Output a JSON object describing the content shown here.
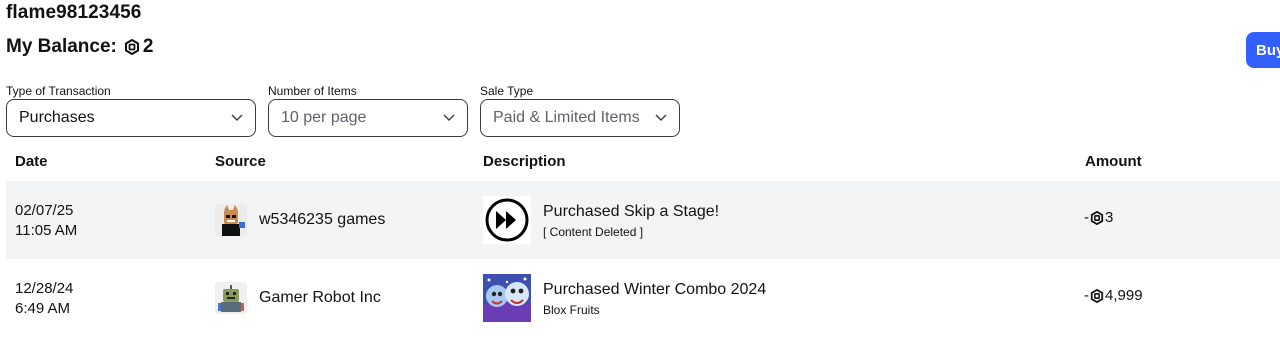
{
  "header": {
    "username": "flame98123456",
    "balance_label": "My Balance:",
    "balance_value": "2",
    "buy_label": "Buy"
  },
  "filters": {
    "type": {
      "label": "Type of Transaction",
      "value": "Purchases"
    },
    "count": {
      "label": "Number of Items",
      "value": "10 per page"
    },
    "sale": {
      "label": "Sale Type",
      "value": "Paid & Limited Items"
    }
  },
  "table": {
    "headers": [
      "Date",
      "Source",
      "Description",
      "Amount"
    ],
    "rows": [
      {
        "date": "02/07/25",
        "time": "11:05 AM",
        "source": "w5346235 games",
        "source_icon": "avatar-icon",
        "description": "Purchased Skip a Stage!",
        "sub": "[ Content Deleted ]",
        "desc_icon": "fast-forward-icon",
        "amount_prefix": "-",
        "amount": "3"
      },
      {
        "date": "12/28/24",
        "time": "6:49 AM",
        "source": "Gamer Robot Inc",
        "source_icon": "robot-group-icon",
        "description": "Purchased Winter Combo 2024",
        "sub": "Blox Fruits",
        "desc_icon": "winter-combo-thumbnail",
        "amount_prefix": "-",
        "amount": "4,999"
      }
    ]
  },
  "colors": {
    "accent": "#335fff",
    "row_shade": "#f2f4f5",
    "text": "#121215"
  }
}
